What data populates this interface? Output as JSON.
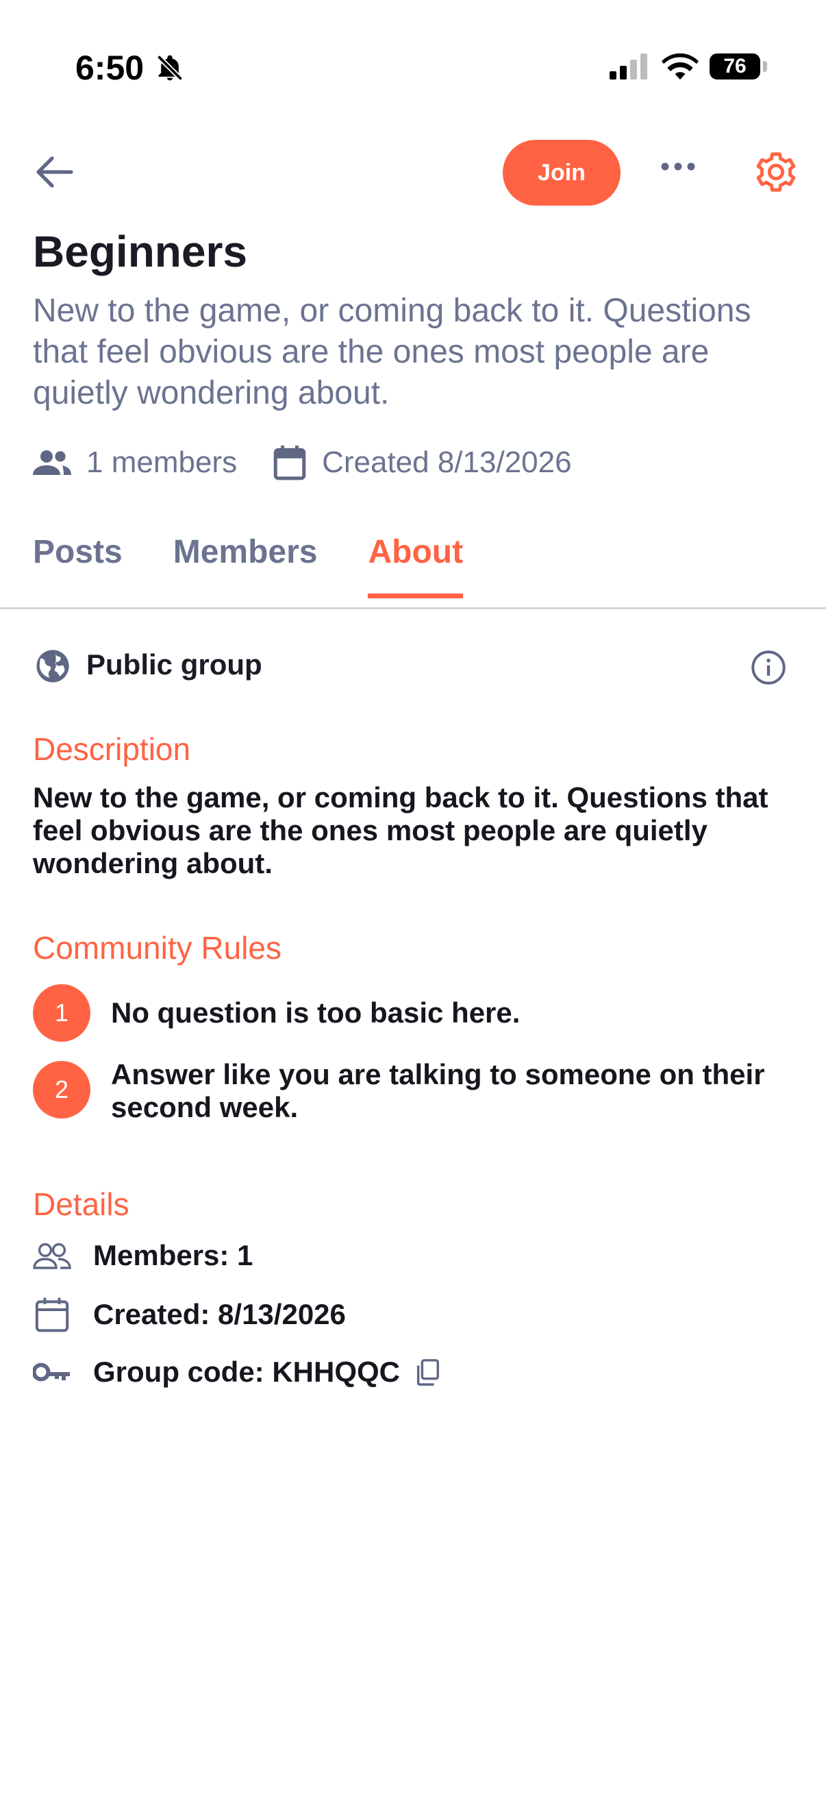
{
  "status_bar": {
    "time": "6:50",
    "battery": "76"
  },
  "toolbar": {
    "join_label": "Join"
  },
  "group": {
    "title": "Beginners",
    "subtitle": "New to the game, or coming back to it. Questions that feel obvious are the ones most people are quietly wondering about.",
    "members_meta": "1 members",
    "created_meta": "Created 8/13/2026"
  },
  "tabs": [
    {
      "label": "Posts",
      "active": false
    },
    {
      "label": "Members",
      "active": false
    },
    {
      "label": "About",
      "active": true
    }
  ],
  "about": {
    "privacy_label": "Public group",
    "description_heading": "Description",
    "description_text": "New to the game, or coming back to it. Questions that feel obvious are the ones most people are quietly wondering about.",
    "rules_heading": "Community Rules",
    "rules": [
      {
        "number": "1",
        "text": "No question is too basic here."
      },
      {
        "number": "2",
        "text": "Answer like you are talking to someone on their second week."
      }
    ],
    "details_heading": "Details",
    "details": {
      "members": "Members: 1",
      "created": "Created: 8/13/2026",
      "group_code": "Group code: KHHQQC"
    }
  },
  "colors": {
    "accent": "#ff6343",
    "muted_text": "#6b7390",
    "dark_text": "#1b1b25"
  },
  "icons": [
    "bell-slash-icon",
    "signal-icon",
    "wifi-icon",
    "back-arrow-icon",
    "more-icon",
    "gear-icon",
    "members-icon",
    "calendar-icon",
    "globe-icon",
    "info-icon",
    "people-outline-icon",
    "calendar-outline-icon",
    "key-icon",
    "copy-icon"
  ]
}
